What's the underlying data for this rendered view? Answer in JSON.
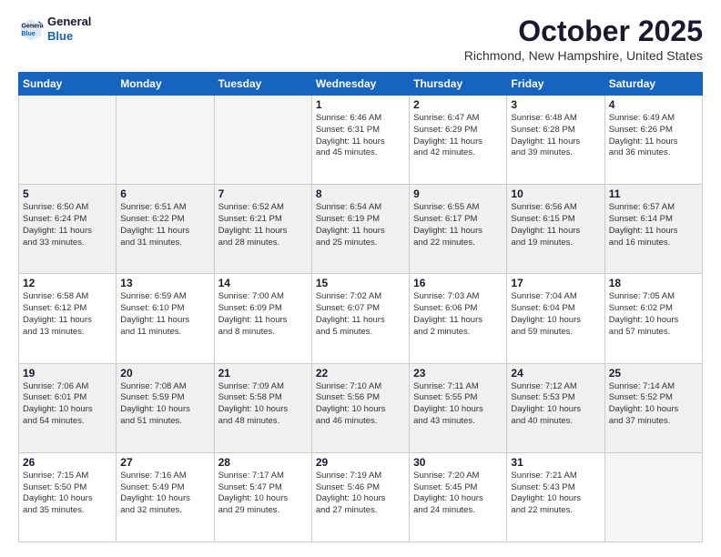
{
  "logo": {
    "line1": "General",
    "line2": "Blue"
  },
  "header": {
    "month": "October 2025",
    "location": "Richmond, New Hampshire, United States"
  },
  "days_of_week": [
    "Sunday",
    "Monday",
    "Tuesday",
    "Wednesday",
    "Thursday",
    "Friday",
    "Saturday"
  ],
  "weeks": [
    [
      {
        "day": "",
        "info": ""
      },
      {
        "day": "",
        "info": ""
      },
      {
        "day": "",
        "info": ""
      },
      {
        "day": "1",
        "info": "Sunrise: 6:46 AM\nSunset: 6:31 PM\nDaylight: 11 hours\nand 45 minutes."
      },
      {
        "day": "2",
        "info": "Sunrise: 6:47 AM\nSunset: 6:29 PM\nDaylight: 11 hours\nand 42 minutes."
      },
      {
        "day": "3",
        "info": "Sunrise: 6:48 AM\nSunset: 6:28 PM\nDaylight: 11 hours\nand 39 minutes."
      },
      {
        "day": "4",
        "info": "Sunrise: 6:49 AM\nSunset: 6:26 PM\nDaylight: 11 hours\nand 36 minutes."
      }
    ],
    [
      {
        "day": "5",
        "info": "Sunrise: 6:50 AM\nSunset: 6:24 PM\nDaylight: 11 hours\nand 33 minutes."
      },
      {
        "day": "6",
        "info": "Sunrise: 6:51 AM\nSunset: 6:22 PM\nDaylight: 11 hours\nand 31 minutes."
      },
      {
        "day": "7",
        "info": "Sunrise: 6:52 AM\nSunset: 6:21 PM\nDaylight: 11 hours\nand 28 minutes."
      },
      {
        "day": "8",
        "info": "Sunrise: 6:54 AM\nSunset: 6:19 PM\nDaylight: 11 hours\nand 25 minutes."
      },
      {
        "day": "9",
        "info": "Sunrise: 6:55 AM\nSunset: 6:17 PM\nDaylight: 11 hours\nand 22 minutes."
      },
      {
        "day": "10",
        "info": "Sunrise: 6:56 AM\nSunset: 6:15 PM\nDaylight: 11 hours\nand 19 minutes."
      },
      {
        "day": "11",
        "info": "Sunrise: 6:57 AM\nSunset: 6:14 PM\nDaylight: 11 hours\nand 16 minutes."
      }
    ],
    [
      {
        "day": "12",
        "info": "Sunrise: 6:58 AM\nSunset: 6:12 PM\nDaylight: 11 hours\nand 13 minutes."
      },
      {
        "day": "13",
        "info": "Sunrise: 6:59 AM\nSunset: 6:10 PM\nDaylight: 11 hours\nand 11 minutes."
      },
      {
        "day": "14",
        "info": "Sunrise: 7:00 AM\nSunset: 6:09 PM\nDaylight: 11 hours\nand 8 minutes."
      },
      {
        "day": "15",
        "info": "Sunrise: 7:02 AM\nSunset: 6:07 PM\nDaylight: 11 hours\nand 5 minutes."
      },
      {
        "day": "16",
        "info": "Sunrise: 7:03 AM\nSunset: 6:06 PM\nDaylight: 11 hours\nand 2 minutes."
      },
      {
        "day": "17",
        "info": "Sunrise: 7:04 AM\nSunset: 6:04 PM\nDaylight: 10 hours\nand 59 minutes."
      },
      {
        "day": "18",
        "info": "Sunrise: 7:05 AM\nSunset: 6:02 PM\nDaylight: 10 hours\nand 57 minutes."
      }
    ],
    [
      {
        "day": "19",
        "info": "Sunrise: 7:06 AM\nSunset: 6:01 PM\nDaylight: 10 hours\nand 54 minutes."
      },
      {
        "day": "20",
        "info": "Sunrise: 7:08 AM\nSunset: 5:59 PM\nDaylight: 10 hours\nand 51 minutes."
      },
      {
        "day": "21",
        "info": "Sunrise: 7:09 AM\nSunset: 5:58 PM\nDaylight: 10 hours\nand 48 minutes."
      },
      {
        "day": "22",
        "info": "Sunrise: 7:10 AM\nSunset: 5:56 PM\nDaylight: 10 hours\nand 46 minutes."
      },
      {
        "day": "23",
        "info": "Sunrise: 7:11 AM\nSunset: 5:55 PM\nDaylight: 10 hours\nand 43 minutes."
      },
      {
        "day": "24",
        "info": "Sunrise: 7:12 AM\nSunset: 5:53 PM\nDaylight: 10 hours\nand 40 minutes."
      },
      {
        "day": "25",
        "info": "Sunrise: 7:14 AM\nSunset: 5:52 PM\nDaylight: 10 hours\nand 37 minutes."
      }
    ],
    [
      {
        "day": "26",
        "info": "Sunrise: 7:15 AM\nSunset: 5:50 PM\nDaylight: 10 hours\nand 35 minutes."
      },
      {
        "day": "27",
        "info": "Sunrise: 7:16 AM\nSunset: 5:49 PM\nDaylight: 10 hours\nand 32 minutes."
      },
      {
        "day": "28",
        "info": "Sunrise: 7:17 AM\nSunset: 5:47 PM\nDaylight: 10 hours\nand 29 minutes."
      },
      {
        "day": "29",
        "info": "Sunrise: 7:19 AM\nSunset: 5:46 PM\nDaylight: 10 hours\nand 27 minutes."
      },
      {
        "day": "30",
        "info": "Sunrise: 7:20 AM\nSunset: 5:45 PM\nDaylight: 10 hours\nand 24 minutes."
      },
      {
        "day": "31",
        "info": "Sunrise: 7:21 AM\nSunset: 5:43 PM\nDaylight: 10 hours\nand 22 minutes."
      },
      {
        "day": "",
        "info": ""
      }
    ]
  ]
}
